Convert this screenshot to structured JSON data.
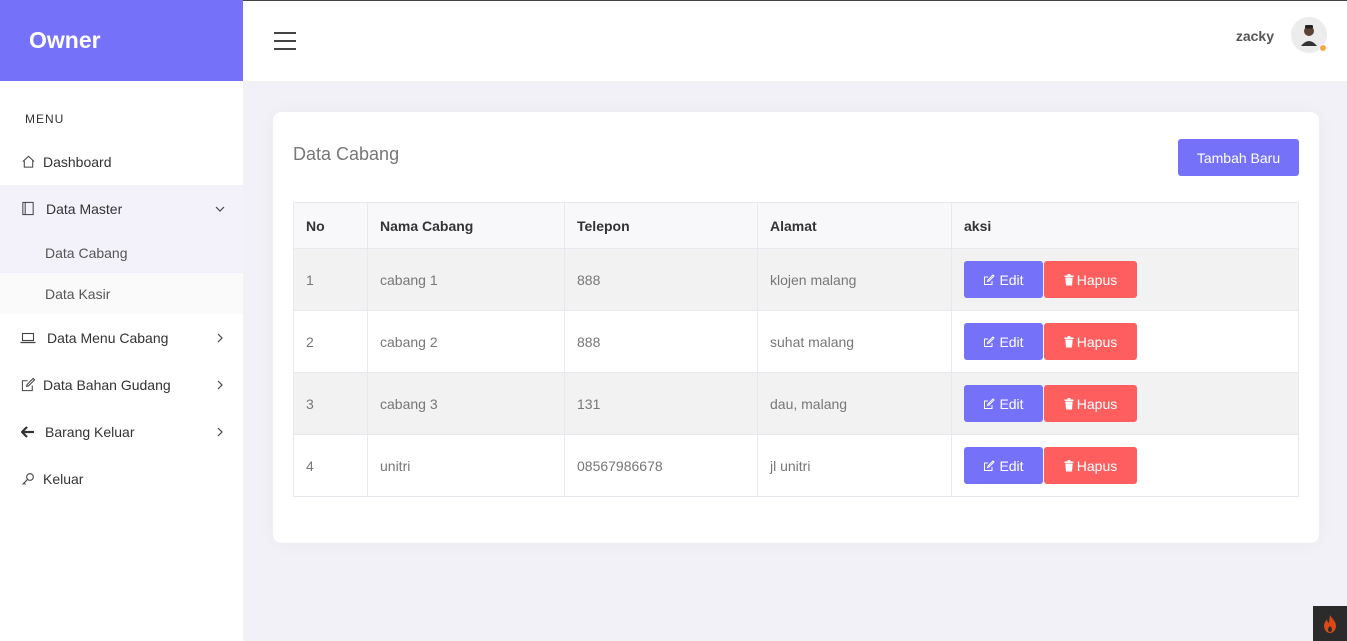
{
  "brand": {
    "title": "Owner"
  },
  "sidebar": {
    "menu_header": "MENU",
    "items": [
      {
        "label": "Dashboard",
        "icon": "home-icon"
      },
      {
        "label": "Data Master",
        "icon": "book-icon",
        "submenu": [
          "Data Cabang",
          "Data Kasir"
        ]
      },
      {
        "label": "Data Menu Cabang",
        "icon": "laptop-icon"
      },
      {
        "label": "Data Bahan Gudang",
        "icon": "edit-icon"
      },
      {
        "label": "Barang Keluar",
        "icon": "arrow-left-icon"
      },
      {
        "label": "Keluar",
        "icon": "key-icon"
      }
    ]
  },
  "topbar": {
    "username": "zacky"
  },
  "card": {
    "title": "Data Cabang",
    "add_button": "Tambah Baru",
    "columns": [
      "No",
      "Nama Cabang",
      "Telepon",
      "Alamat",
      "aksi"
    ],
    "rows": [
      {
        "no": "1",
        "nama": "cabang 1",
        "telepon": "888",
        "alamat": "klojen malang"
      },
      {
        "no": "2",
        "nama": "cabang 2",
        "telepon": "888",
        "alamat": "suhat malang"
      },
      {
        "no": "3",
        "nama": "cabang 3",
        "telepon": "131",
        "alamat": "dau, malang"
      },
      {
        "no": "4",
        "nama": "unitri",
        "telepon": "08567986678",
        "alamat": "jl unitri"
      }
    ],
    "edit_label": "Edit",
    "delete_label": "Hapus"
  },
  "colors": {
    "primary": "#7571f9",
    "danger": "#ff5e5e",
    "background": "#f1f1f7"
  }
}
